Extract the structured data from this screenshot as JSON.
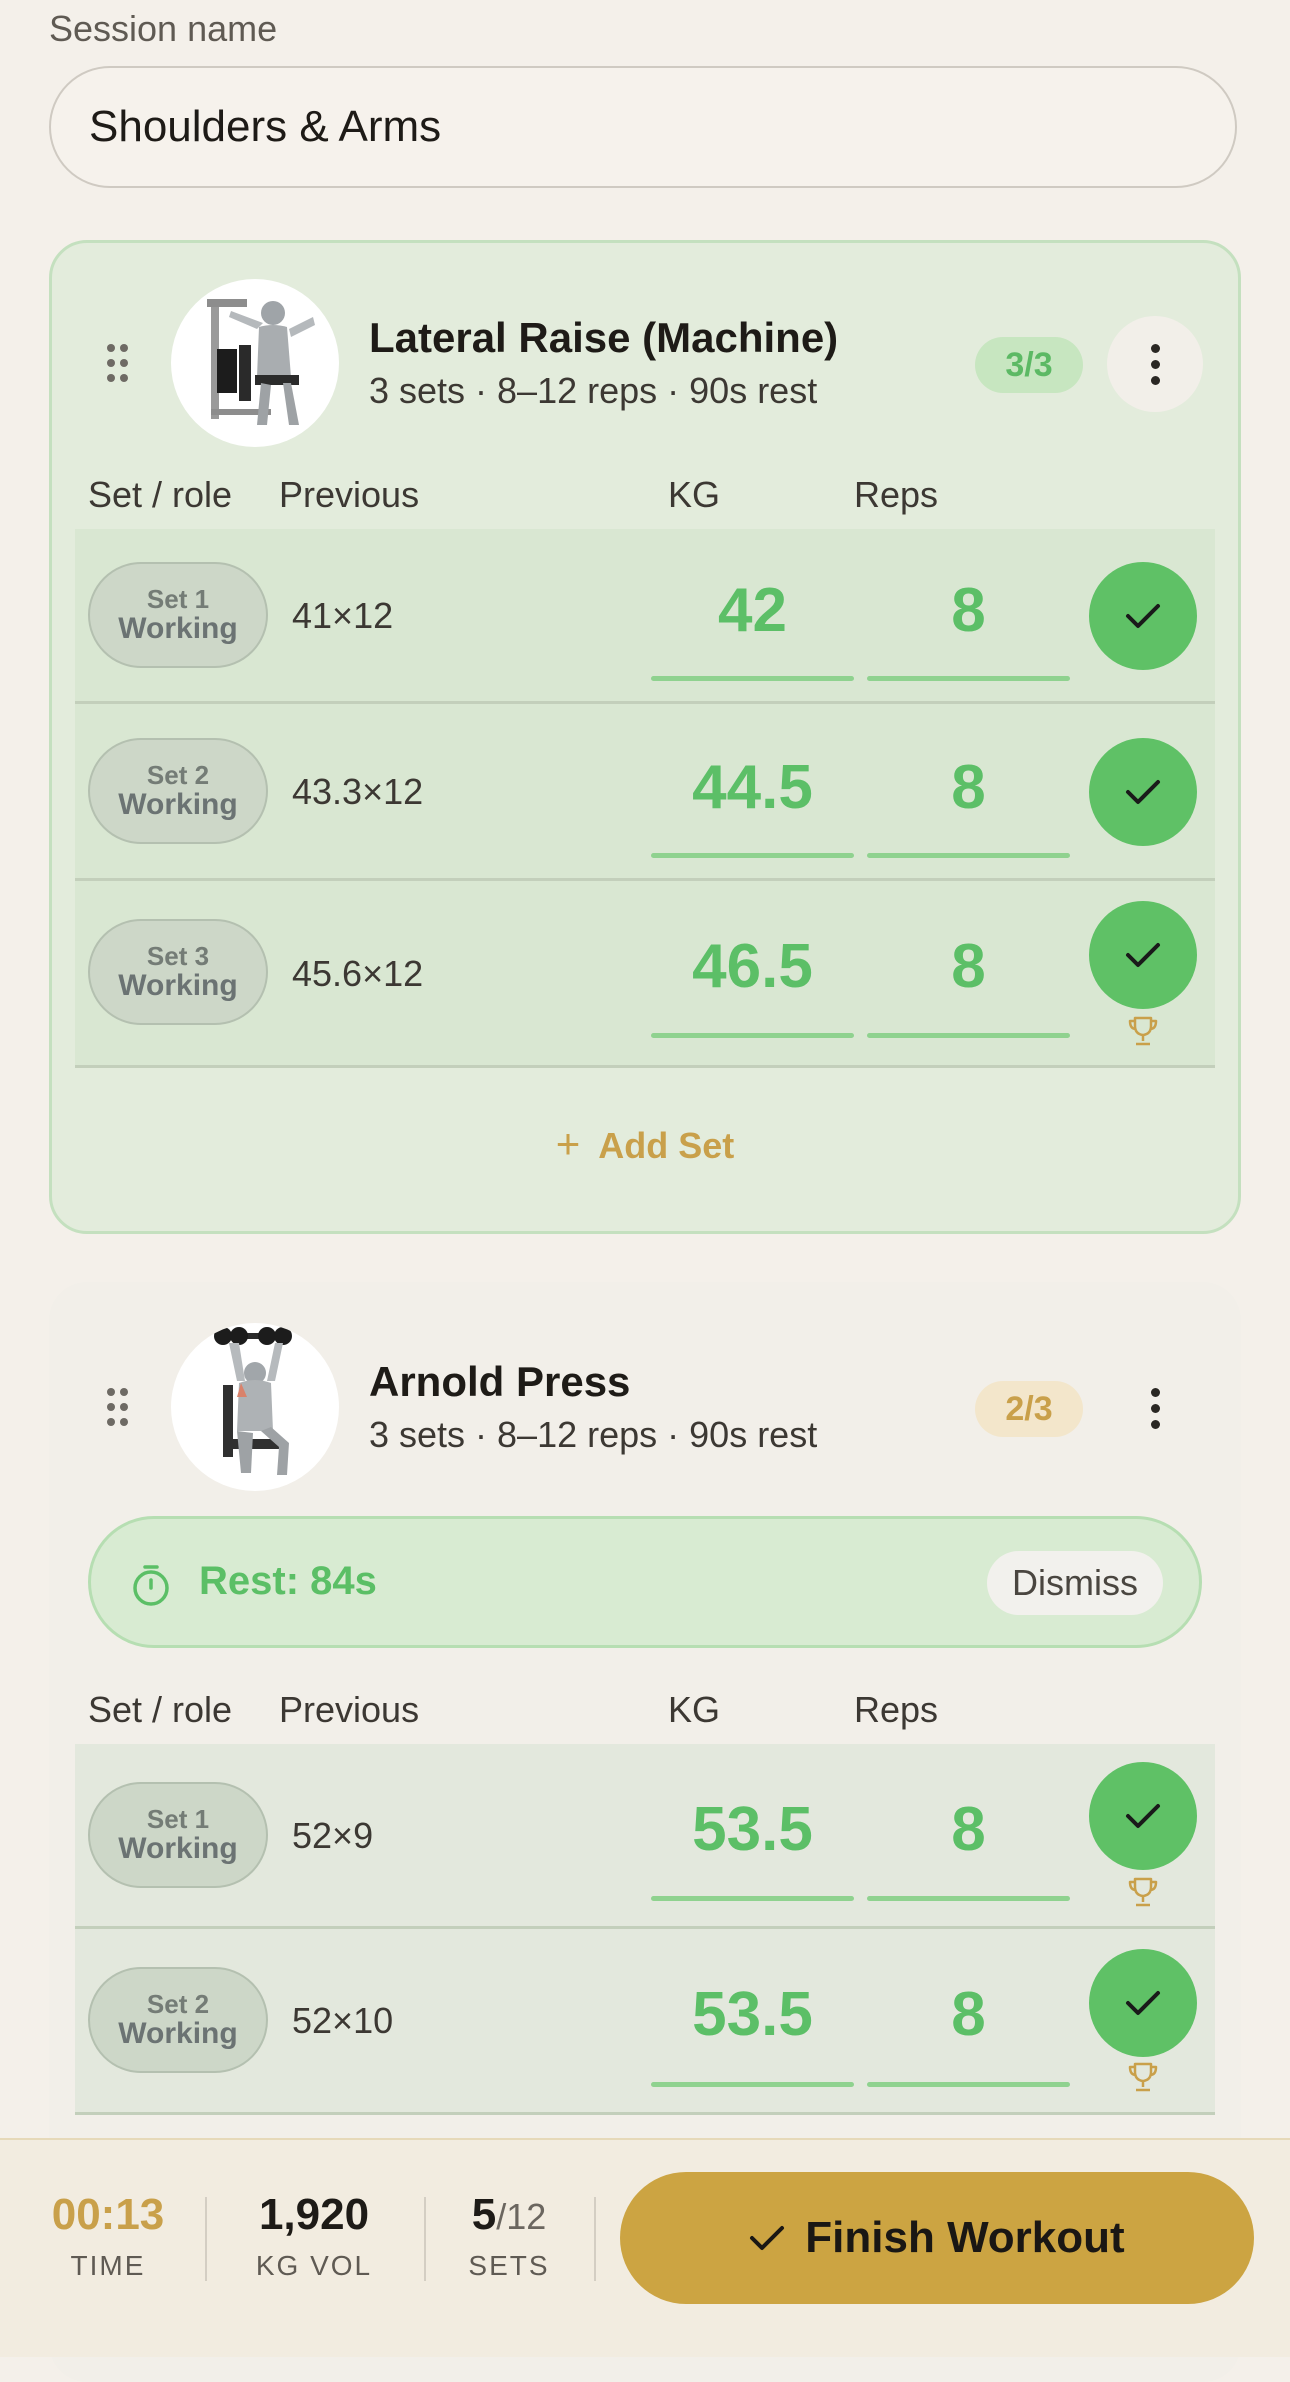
{
  "session": {
    "label": "Session name",
    "value": "Shoulders & Arms"
  },
  "table_headers": {
    "role": "Set / role",
    "previous": "Previous",
    "kg": "KG",
    "reps": "Reps"
  },
  "exercises": [
    {
      "name": "Lateral Raise (Machine)",
      "subtitle": "3 sets · 8–12 reps · 90s rest",
      "progress": "3/3",
      "add_set_label": "Add Set",
      "sets": [
        {
          "set": "Set 1",
          "role": "Working",
          "previous": "41×12",
          "kg": "42",
          "reps": "8",
          "done": true,
          "pr": false
        },
        {
          "set": "Set 2",
          "role": "Working",
          "previous": "43.3×12",
          "kg": "44.5",
          "reps": "8",
          "done": true,
          "pr": false
        },
        {
          "set": "Set 3",
          "role": "Working",
          "previous": "45.6×12",
          "kg": "46.5",
          "reps": "8",
          "done": true,
          "pr": true
        }
      ]
    },
    {
      "name": "Arnold Press",
      "subtitle": "3 sets · 8–12 reps · 90s rest",
      "progress": "2/3",
      "rest_timer": {
        "text": "Rest: 84s",
        "dismiss_label": "Dismiss"
      },
      "sets": [
        {
          "set": "Set 1",
          "role": "Working",
          "previous": "52×9",
          "kg": "53.5",
          "reps": "8",
          "done": true,
          "pr": true
        },
        {
          "set": "Set 2",
          "role": "Working",
          "previous": "52×10",
          "kg": "53.5",
          "reps": "8",
          "done": true,
          "pr": true
        }
      ]
    }
  ],
  "footer": {
    "time": {
      "value": "00:13",
      "label": "TIME"
    },
    "volume": {
      "value": "1,920",
      "label": "KG VOL"
    },
    "sets": {
      "value": "5",
      "total": "/12",
      "label": "SETS"
    },
    "finish_label": "Finish Workout"
  },
  "colors": {
    "accent_green": "#5fc166",
    "accent_amber": "#cca442",
    "background": "#f4f0ea"
  },
  "icons": [
    "drag-handle-icon",
    "more-vertical-icon",
    "check-icon",
    "trophy-icon",
    "stopwatch-icon",
    "plus-icon"
  ]
}
